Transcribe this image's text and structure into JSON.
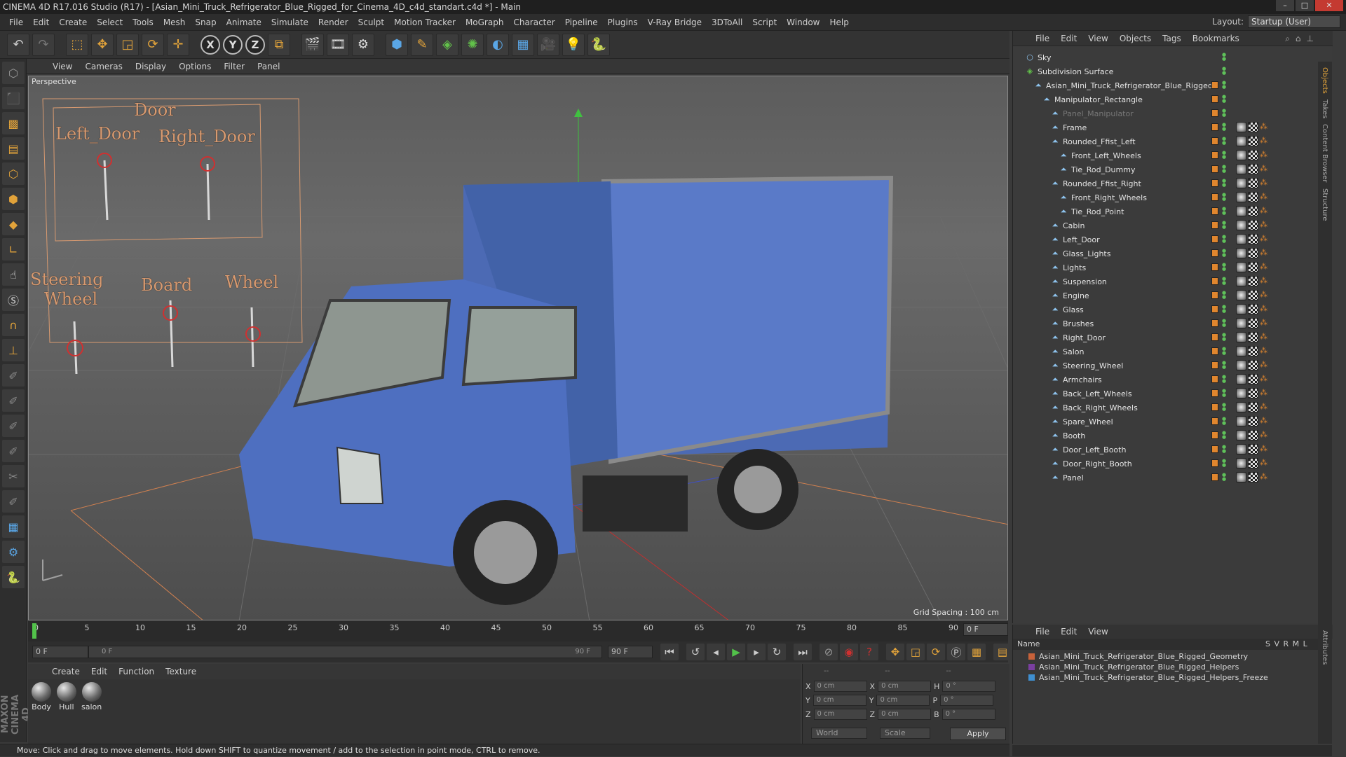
{
  "window": {
    "title": "CINEMA 4D R17.016 Studio (R17) - [Asian_Mini_Truck_Refrigerator_Blue_Rigged_for_Cinema_4D_c4d_standart.c4d *] - Main"
  },
  "menubar": [
    "File",
    "Edit",
    "Create",
    "Select",
    "Tools",
    "Mesh",
    "Snap",
    "Animate",
    "Simulate",
    "Render",
    "Sculpt",
    "Motion Tracker",
    "MoGraph",
    "Character",
    "Pipeline",
    "Plugins",
    "V-Ray Bridge",
    "3DToAll",
    "Script",
    "Window",
    "Help"
  ],
  "layout": {
    "label": "Layout:",
    "value": "Startup (User)"
  },
  "toolbar": {
    "axis_x": "X",
    "axis_y": "Y",
    "axis_z": "Z"
  },
  "viewport": {
    "menu": [
      "View",
      "Cameras",
      "Display",
      "Options",
      "Filter",
      "Panel"
    ],
    "label": "Perspective",
    "grid_spacing": "Grid Spacing : 100 cm",
    "rig_labels": {
      "door": "Door",
      "left_door": "Left_Door",
      "right_door": "Right_Door",
      "steering": "Steering",
      "wheel_1": "Wheel",
      "board": "Board",
      "wheel_2": "Wheel"
    }
  },
  "timeline": {
    "ticks": [
      "0",
      "5",
      "10",
      "15",
      "20",
      "25",
      "30",
      "35",
      "40",
      "45",
      "50",
      "55",
      "60",
      "65",
      "70",
      "75",
      "80",
      "85",
      "90"
    ],
    "end_field": "0 F"
  },
  "transport": {
    "start": "0 F",
    "slider_start": "0 F",
    "slider_end": "90 F",
    "end": "90 F"
  },
  "materials": {
    "menu": [
      "Create",
      "Edit",
      "Function",
      "Texture"
    ],
    "items": [
      "Body",
      "Hull",
      "salon"
    ]
  },
  "coords": {
    "rows": [
      {
        "a": "X",
        "av": "0 cm",
        "b": "X",
        "bv": "0 cm",
        "c": "H",
        "cv": "0 °"
      },
      {
        "a": "Y",
        "av": "0 cm",
        "b": "Y",
        "bv": "0 cm",
        "c": "P",
        "cv": "0 °"
      },
      {
        "a": "Z",
        "av": "0 cm",
        "b": "Z",
        "bv": "0 cm",
        "c": "B",
        "cv": "0 °"
      }
    ],
    "mode": "World",
    "scale": "Scale",
    "apply": "Apply",
    "head1": "--",
    "head2": "--",
    "head3": "--"
  },
  "status": "Move: Click and drag to move elements. Hold down SHIFT to quantize movement / add to the selection in point mode, CTRL to remove.",
  "objects": {
    "menu": [
      "File",
      "Edit",
      "View",
      "Objects",
      "Tags",
      "Bookmarks"
    ],
    "items": [
      {
        "name": "Sky",
        "level": 0
      },
      {
        "name": "Subdivision Surface",
        "level": 0
      },
      {
        "name": "Asian_Mini_Truck_Refrigerator_Blue_Rigged",
        "level": 1
      },
      {
        "name": "Manipulator_Rectangle",
        "level": 2
      },
      {
        "name": "Panel_Manipulator",
        "level": 3
      },
      {
        "name": "Frame",
        "level": 3
      },
      {
        "name": "Rounded_Ffist_Left",
        "level": 3
      },
      {
        "name": "Front_Left_Wheels",
        "level": 4
      },
      {
        "name": "Tie_Rod_Dummy",
        "level": 4
      },
      {
        "name": "Rounded_Ffist_Right",
        "level": 3
      },
      {
        "name": "Front_Right_Wheels",
        "level": 4
      },
      {
        "name": "Tie_Rod_Point",
        "level": 4
      },
      {
        "name": "Cabin",
        "level": 3
      },
      {
        "name": "Left_Door",
        "level": 3
      },
      {
        "name": "Glass_Lights",
        "level": 3
      },
      {
        "name": "Lights",
        "level": 3
      },
      {
        "name": "Suspension",
        "level": 3
      },
      {
        "name": "Engine",
        "level": 3
      },
      {
        "name": "Glass",
        "level": 3
      },
      {
        "name": "Brushes",
        "level": 3
      },
      {
        "name": "Right_Door",
        "level": 3
      },
      {
        "name": "Salon",
        "level": 3
      },
      {
        "name": "Steering_Wheel",
        "level": 3
      },
      {
        "name": "Armchairs",
        "level": 3
      },
      {
        "name": "Back_Left_Wheels",
        "level": 3
      },
      {
        "name": "Back_Right_Wheels",
        "level": 3
      },
      {
        "name": "Spare_Wheel",
        "level": 3
      },
      {
        "name": "Booth",
        "level": 3
      },
      {
        "name": "Door_Left_Booth",
        "level": 3
      },
      {
        "name": "Door_Right_Booth",
        "level": 3
      },
      {
        "name": "Panel",
        "level": 3
      }
    ],
    "side_tabs": [
      "Objects",
      "Takes",
      "Content Browser",
      "Structure"
    ]
  },
  "layers": {
    "menu": [
      "File",
      "Edit",
      "View"
    ],
    "header": "Name",
    "cols": "S  V  R  M  L",
    "items": [
      {
        "name": "Asian_Mini_Truck_Refrigerator_Blue_Rigged_Geometry",
        "color": "#c8623a"
      },
      {
        "name": "Asian_Mini_Truck_Refrigerator_Blue_Rigged_Helpers",
        "color": "#7a3fa0"
      },
      {
        "name": "Asian_Mini_Truck_Refrigerator_Blue_Rigged_Helpers_Freeze",
        "color": "#3f8fd0"
      }
    ]
  },
  "logo": "MAXON CINEMA 4D"
}
